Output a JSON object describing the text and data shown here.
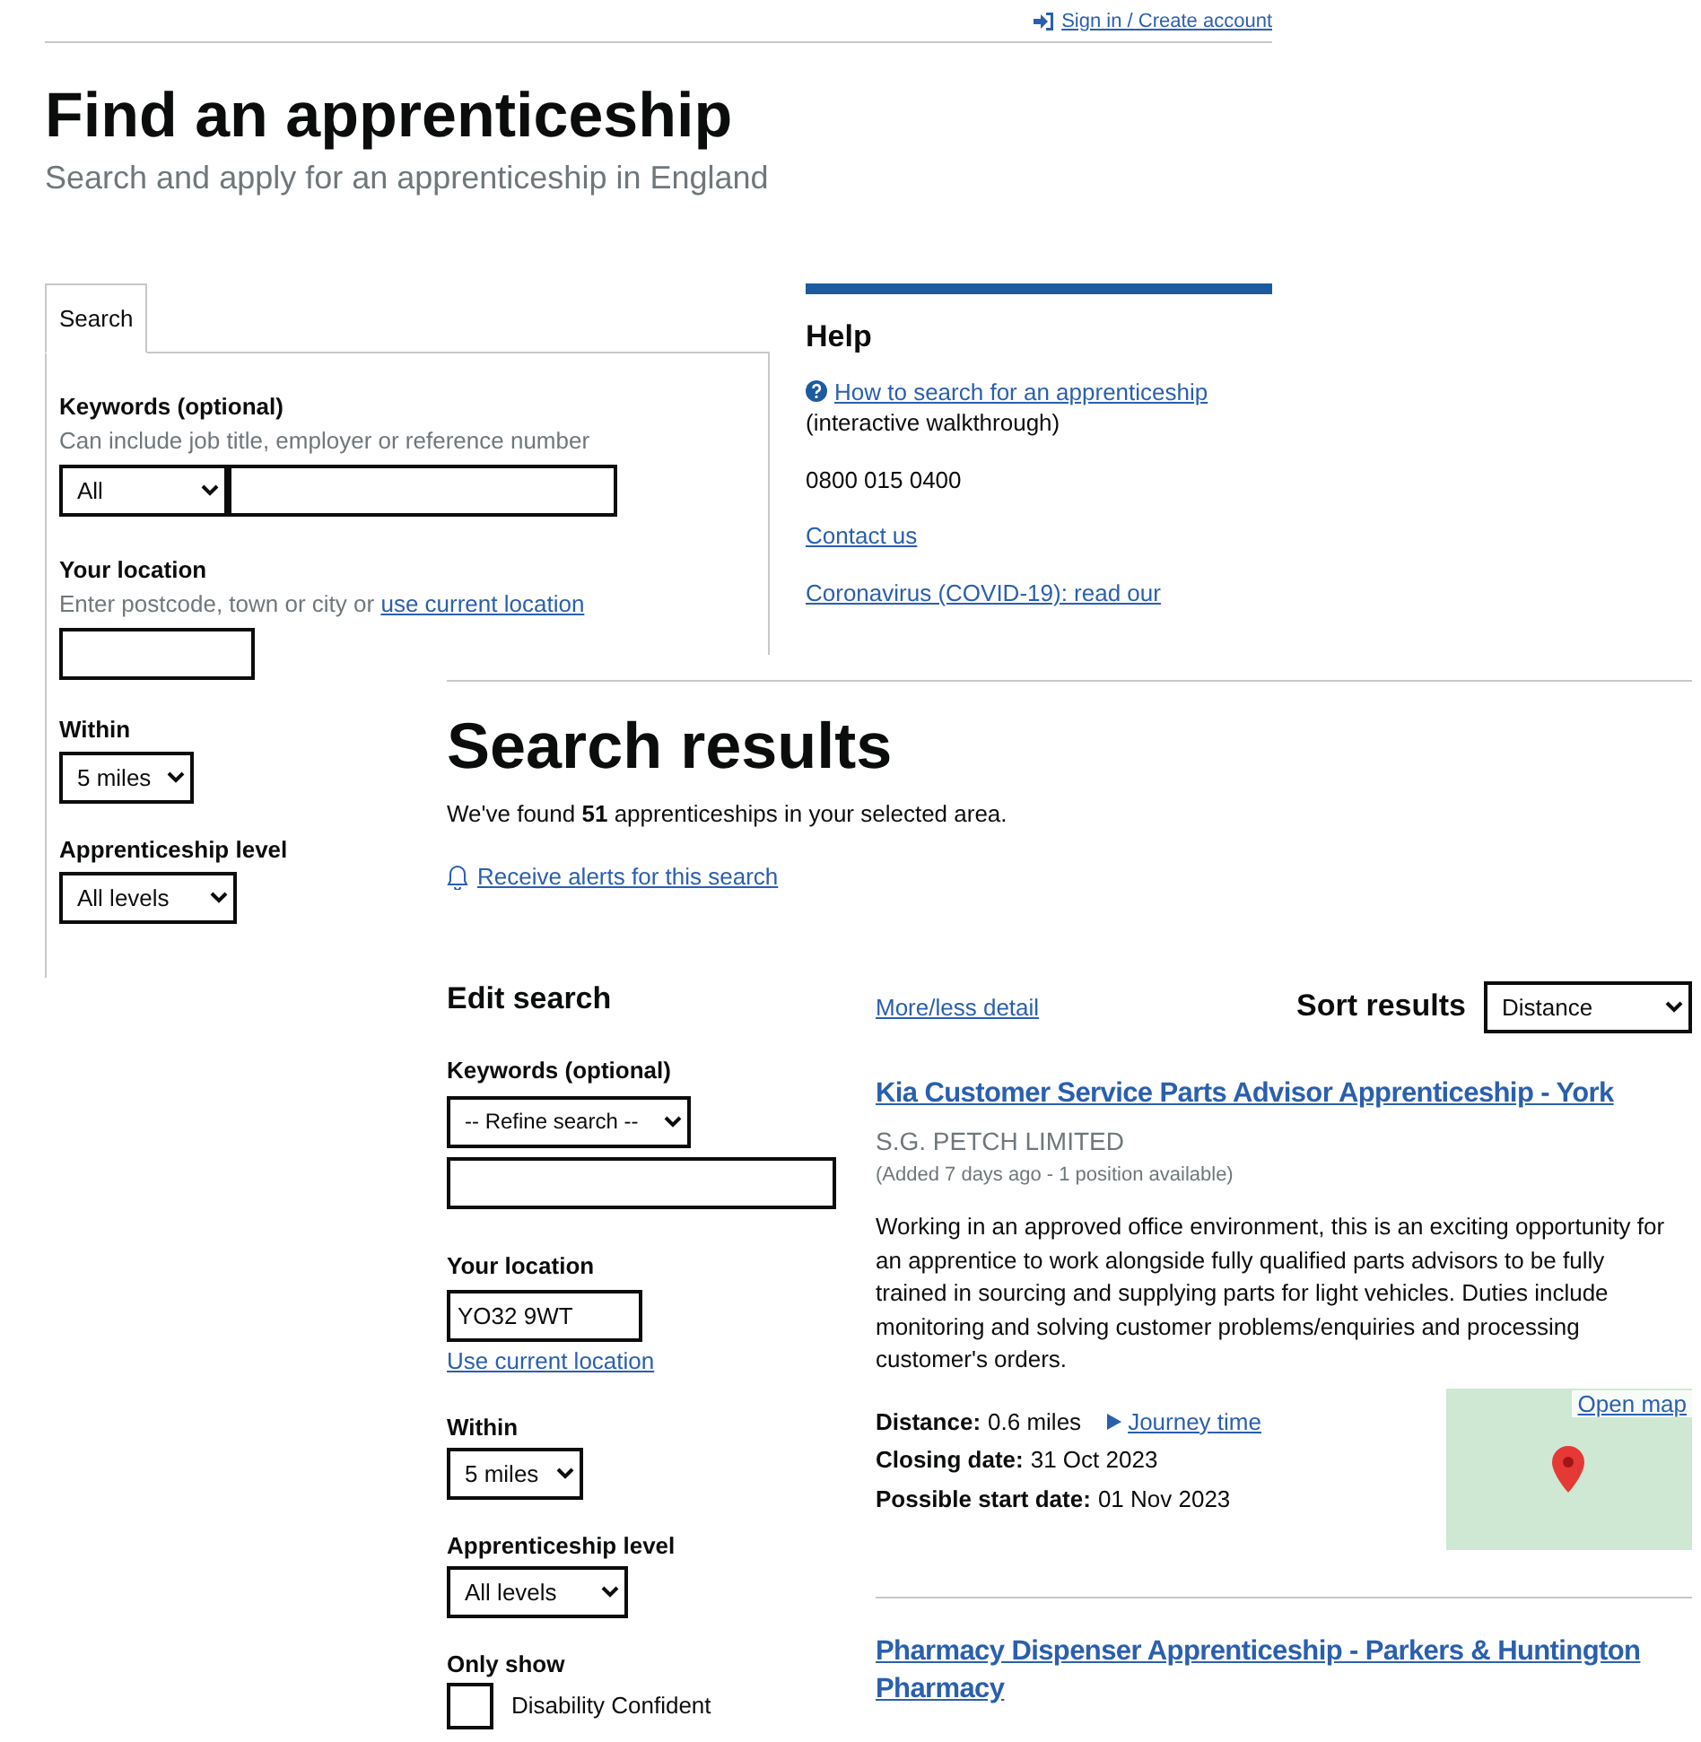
{
  "header": {
    "sign_in_link": "Sign in / Create account"
  },
  "page": {
    "title": "Find an apprenticeship",
    "subtitle": "Search and apply for an apprenticeship in England"
  },
  "search_tabs": [
    {
      "label": "Search",
      "selected": true
    }
  ],
  "search_form": {
    "keywords": {
      "label": "Keywords (optional)",
      "hint": "Can include job title, employer or reference number",
      "category": "All"
    },
    "location": {
      "label": "Your location",
      "hint": "Enter postcode, town or city or",
      "hint_link": "use current location"
    },
    "within": {
      "label": "Within",
      "value": "5 miles"
    },
    "level": {
      "label": "Apprenticeship level",
      "value": "All levels"
    }
  },
  "help": {
    "title": "Help",
    "walkthrough_link": "How to search for an apprenticeship",
    "walkthrough_note": "(interactive walkthrough)",
    "phone": "0800 015 0400",
    "contact_link": "Contact us",
    "covid_link": "Coronavirus (COVID-19): read our"
  },
  "results": {
    "title": "Search results",
    "summary": "We've found **51** apprenticeships in your selected area.",
    "alerts_link": "Receive alerts for this search",
    "edit_search": {
      "title": "Edit search",
      "keywords": {
        "label": "Keywords (optional)",
        "refine": "-- Refine search --"
      },
      "location": {
        "label": "Your location",
        "value": "YO32 9WT",
        "link": "Use current location"
      },
      "within": {
        "label": "Within",
        "value": "5 miles"
      },
      "level": {
        "label": "Apprenticeship level",
        "value": "All levels"
      },
      "only_show": {
        "label": "Only show",
        "options": [
          {
            "label": "Disability Confident",
            "checked": false
          }
        ]
      }
    },
    "more_less_link": "More/less detail",
    "sort": {
      "label": "Sort results",
      "value": "Distance"
    },
    "vacancies": [
      {
        "kind": "full",
        "title": "Kia Customer Service Parts Advisor Apprenticeship - York",
        "employer": "S.G. PETCH LIMITED",
        "meta": "(Added 7 days ago - 1 position available)",
        "description": "Working in an approved office environment, this is an exciting opportunity for an apprentice to work alongside fully qualified parts advisors to be fully trained in sourcing and supplying parts for light vehicles. Duties include monitoring and solving customer problems/enquiries and processing customer's orders.",
        "distance_label": "Distance:",
        "distance": "0.6 miles",
        "journey_link": "Journey time",
        "closing_label": "Closing date:",
        "closing": "31 Oct 2023",
        "start_label": "Possible start date:",
        "start": "01 Nov 2023",
        "map_link": "Open map"
      },
      {
        "kind": "title_only",
        "title": "Pharmacy Dispenser Apprenticeship - Parkers & Huntington Pharmacy"
      }
    ]
  }
}
